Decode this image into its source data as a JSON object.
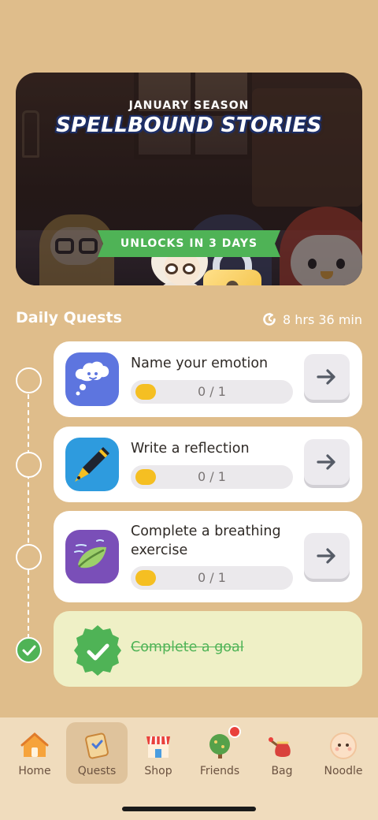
{
  "banner": {
    "season": "JANUARY SEASON",
    "title": "SPELLBOUND STORIES",
    "unlock": "UNLOCKS IN 3 DAYS"
  },
  "daily": {
    "title": "Daily Quests",
    "timer": "8 hrs 36 min"
  },
  "quests": [
    {
      "label": "Name your emotion",
      "progress_text": "0 / 1",
      "progress": 0,
      "icon": "thought-cloud-icon",
      "color": "#5d75df"
    },
    {
      "label": "Write a reflection",
      "progress_text": "0 / 1",
      "progress": 0,
      "icon": "pen-icon",
      "color": "#2e9bde"
    },
    {
      "label": "Complete a breathing exercise",
      "progress_text": "0 / 1",
      "progress": 0,
      "icon": "leaf-icon",
      "color": "#7a4fb8"
    }
  ],
  "goal": {
    "label": "Complete a goal",
    "done": true,
    "icon": "check-badge-icon"
  },
  "nav": [
    {
      "label": "Home",
      "icon": "house-icon"
    },
    {
      "label": "Quests",
      "icon": "quest-scroll-icon",
      "active": true
    },
    {
      "label": "Shop",
      "icon": "shop-icon"
    },
    {
      "label": "Friends",
      "icon": "tree-icon",
      "notification": true
    },
    {
      "label": "Bag",
      "icon": "bag-icon"
    },
    {
      "label": "Noodle",
      "icon": "noodle-face-icon"
    }
  ],
  "colors": {
    "background": "#dfbd8b",
    "accent_green": "#4fb356",
    "nav_bg": "#f0dcbd"
  }
}
